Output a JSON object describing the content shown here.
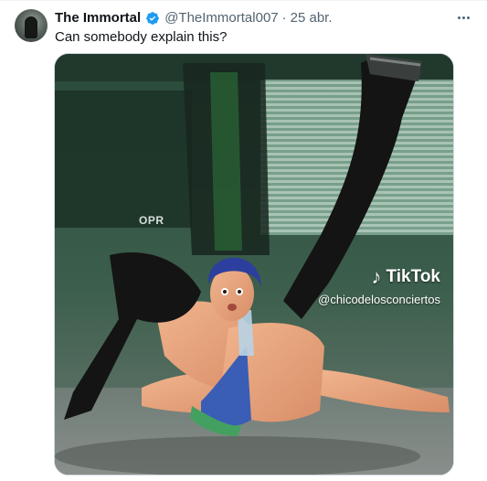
{
  "author": {
    "display_name": "The Immortal",
    "handle": "@TheImmortal007",
    "separator": "·",
    "date": "25 abr.",
    "verified": true,
    "verified_color": "#1d9bf0"
  },
  "tweet": {
    "text": "Can somebody explain this?"
  },
  "menu": {
    "icon": "more-horizontal-icon"
  },
  "media": {
    "type": "video-still",
    "stage_sign": "OPR",
    "watermark": {
      "logo_icon": "tiktok-icon",
      "brand": "TikTok",
      "username": "@chicodelosconciertos"
    }
  },
  "colors": {
    "text_primary": "#0f1419",
    "text_secondary": "#536471",
    "border": "#cfd9de"
  }
}
